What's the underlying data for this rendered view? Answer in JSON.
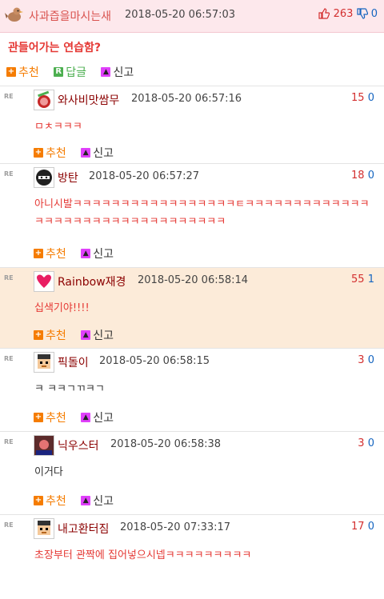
{
  "post": {
    "nickname": "사과즙을마시는새",
    "date": "2018-05-20 06:57:03",
    "up": "263",
    "down": "0",
    "title": "관들어가는 연습함?",
    "actions": {
      "recommend": "추천",
      "reply": "답글",
      "report": "신고"
    }
  },
  "comments": [
    {
      "nick": "와사비맛쌈무",
      "date": "2018-05-20 06:57:16",
      "up": "15",
      "down": "0",
      "body": "ㅁㅊㅋㅋㅋ",
      "body2": "",
      "recommend": "추천",
      "report": "신고",
      "badge": "RE"
    },
    {
      "nick": "방탄",
      "date": "2018-05-20 06:57:27",
      "up": "18",
      "down": "0",
      "body": "아니시발ㅋㅋㅋㅋㅋㅋㅋㅋㅋㅋㅋㅋㅋㅋㅋㅋㅋㅌㅋㅋㅋㅋㅋㅋㅋㅋㅋㅋㅋㅋㅋ",
      "body2": "ㅋㅋㅋㅋㅋㅋㅋㅋㅋㅋㅋㅋㅋㅋㅋㅋㅋㅋㅋㅋ",
      "recommend": "추천",
      "report": "신고",
      "badge": "RE"
    },
    {
      "nick": "Rainbow재경",
      "date": "2018-05-20 06:58:14",
      "up": "55",
      "down": "1",
      "body": "십색기야!!!!",
      "body2": "",
      "recommend": "추천",
      "report": "신고",
      "badge": "RE"
    },
    {
      "nick": "픽돌이",
      "date": "2018-05-20 06:58:15",
      "up": "3",
      "down": "0",
      "body": "ㅋ ㅋㅋㄱㄲㅋㄱ",
      "body2": "",
      "recommend": "추천",
      "report": "신고",
      "badge": "RE"
    },
    {
      "nick": "닉우스터",
      "date": "2018-05-20 06:58:38",
      "up": "3",
      "down": "0",
      "body": "이거다",
      "body2": "",
      "recommend": "추천",
      "report": "신고",
      "badge": "RE"
    },
    {
      "nick": "내고환터짐",
      "date": "2018-05-20 07:33:17",
      "up": "17",
      "down": "0",
      "body": "초장부터 관짝에 집어넣으시넵ㅋㅋㅋㅋㅋㅋㅋㅋㅋ",
      "body2": "",
      "recommend": "추천",
      "report": "신고",
      "badge": "RE"
    }
  ],
  "icons": {
    "thumb_up": "thumbs-up-icon",
    "thumb_down": "thumbs-down-icon",
    "plus": "plus-icon",
    "reply": "reply-icon",
    "report": "alarm-icon"
  },
  "colors": {
    "header_bg": "#fde8ec",
    "highlight_bg": "#fcebd9",
    "up": "#d32f2f",
    "down": "#1565c0",
    "accent": "#f57c00"
  }
}
